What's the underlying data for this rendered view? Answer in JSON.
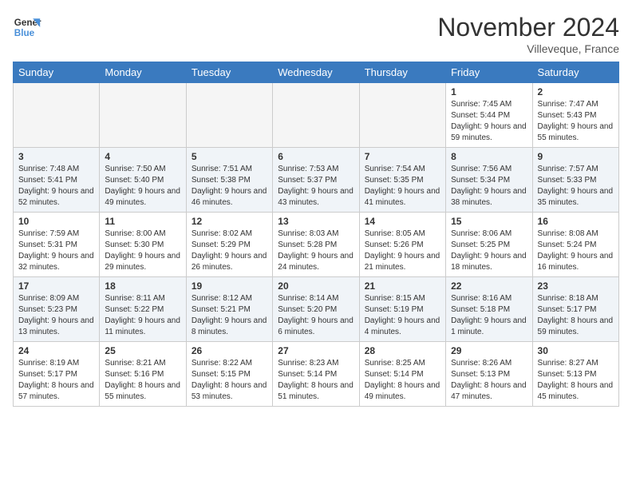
{
  "header": {
    "logo_line1": "General",
    "logo_line2": "Blue",
    "month_title": "November 2024",
    "location": "Villeveque, France"
  },
  "days_of_week": [
    "Sunday",
    "Monday",
    "Tuesday",
    "Wednesday",
    "Thursday",
    "Friday",
    "Saturday"
  ],
  "weeks": [
    [
      {
        "day": "",
        "empty": true
      },
      {
        "day": "",
        "empty": true
      },
      {
        "day": "",
        "empty": true
      },
      {
        "day": "",
        "empty": true
      },
      {
        "day": "",
        "empty": true
      },
      {
        "day": "1",
        "sunrise": "7:45 AM",
        "sunset": "5:44 PM",
        "daylight": "9 hours and 59 minutes."
      },
      {
        "day": "2",
        "sunrise": "7:47 AM",
        "sunset": "5:43 PM",
        "daylight": "9 hours and 55 minutes."
      }
    ],
    [
      {
        "day": "3",
        "sunrise": "7:48 AM",
        "sunset": "5:41 PM",
        "daylight": "9 hours and 52 minutes."
      },
      {
        "day": "4",
        "sunrise": "7:50 AM",
        "sunset": "5:40 PM",
        "daylight": "9 hours and 49 minutes."
      },
      {
        "day": "5",
        "sunrise": "7:51 AM",
        "sunset": "5:38 PM",
        "daylight": "9 hours and 46 minutes."
      },
      {
        "day": "6",
        "sunrise": "7:53 AM",
        "sunset": "5:37 PM",
        "daylight": "9 hours and 43 minutes."
      },
      {
        "day": "7",
        "sunrise": "7:54 AM",
        "sunset": "5:35 PM",
        "daylight": "9 hours and 41 minutes."
      },
      {
        "day": "8",
        "sunrise": "7:56 AM",
        "sunset": "5:34 PM",
        "daylight": "9 hours and 38 minutes."
      },
      {
        "day": "9",
        "sunrise": "7:57 AM",
        "sunset": "5:33 PM",
        "daylight": "9 hours and 35 minutes."
      }
    ],
    [
      {
        "day": "10",
        "sunrise": "7:59 AM",
        "sunset": "5:31 PM",
        "daylight": "9 hours and 32 minutes."
      },
      {
        "day": "11",
        "sunrise": "8:00 AM",
        "sunset": "5:30 PM",
        "daylight": "9 hours and 29 minutes."
      },
      {
        "day": "12",
        "sunrise": "8:02 AM",
        "sunset": "5:29 PM",
        "daylight": "9 hours and 26 minutes."
      },
      {
        "day": "13",
        "sunrise": "8:03 AM",
        "sunset": "5:28 PM",
        "daylight": "9 hours and 24 minutes."
      },
      {
        "day": "14",
        "sunrise": "8:05 AM",
        "sunset": "5:26 PM",
        "daylight": "9 hours and 21 minutes."
      },
      {
        "day": "15",
        "sunrise": "8:06 AM",
        "sunset": "5:25 PM",
        "daylight": "9 hours and 18 minutes."
      },
      {
        "day": "16",
        "sunrise": "8:08 AM",
        "sunset": "5:24 PM",
        "daylight": "9 hours and 16 minutes."
      }
    ],
    [
      {
        "day": "17",
        "sunrise": "8:09 AM",
        "sunset": "5:23 PM",
        "daylight": "9 hours and 13 minutes."
      },
      {
        "day": "18",
        "sunrise": "8:11 AM",
        "sunset": "5:22 PM",
        "daylight": "9 hours and 11 minutes."
      },
      {
        "day": "19",
        "sunrise": "8:12 AM",
        "sunset": "5:21 PM",
        "daylight": "9 hours and 8 minutes."
      },
      {
        "day": "20",
        "sunrise": "8:14 AM",
        "sunset": "5:20 PM",
        "daylight": "9 hours and 6 minutes."
      },
      {
        "day": "21",
        "sunrise": "8:15 AM",
        "sunset": "5:19 PM",
        "daylight": "9 hours and 4 minutes."
      },
      {
        "day": "22",
        "sunrise": "8:16 AM",
        "sunset": "5:18 PM",
        "daylight": "9 hours and 1 minute."
      },
      {
        "day": "23",
        "sunrise": "8:18 AM",
        "sunset": "5:17 PM",
        "daylight": "8 hours and 59 minutes."
      }
    ],
    [
      {
        "day": "24",
        "sunrise": "8:19 AM",
        "sunset": "5:17 PM",
        "daylight": "8 hours and 57 minutes."
      },
      {
        "day": "25",
        "sunrise": "8:21 AM",
        "sunset": "5:16 PM",
        "daylight": "8 hours and 55 minutes."
      },
      {
        "day": "26",
        "sunrise": "8:22 AM",
        "sunset": "5:15 PM",
        "daylight": "8 hours and 53 minutes."
      },
      {
        "day": "27",
        "sunrise": "8:23 AM",
        "sunset": "5:14 PM",
        "daylight": "8 hours and 51 minutes."
      },
      {
        "day": "28",
        "sunrise": "8:25 AM",
        "sunset": "5:14 PM",
        "daylight": "8 hours and 49 minutes."
      },
      {
        "day": "29",
        "sunrise": "8:26 AM",
        "sunset": "5:13 PM",
        "daylight": "8 hours and 47 minutes."
      },
      {
        "day": "30",
        "sunrise": "8:27 AM",
        "sunset": "5:13 PM",
        "daylight": "8 hours and 45 minutes."
      }
    ]
  ]
}
